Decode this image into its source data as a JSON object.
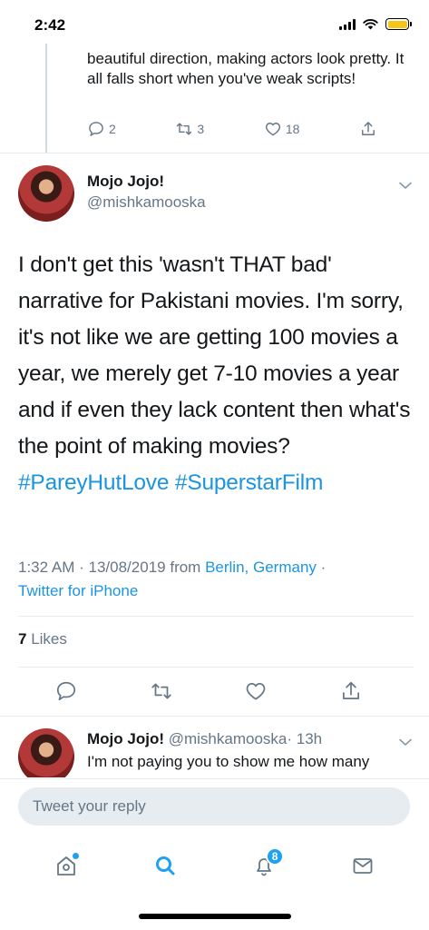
{
  "status_bar": {
    "time": "2:42"
  },
  "previous_tweet": {
    "text": "beautiful direction, making actors look pretty. It all falls short when you've weak scripts!",
    "reply_count": "2",
    "retweet_count": "3",
    "like_count": "18",
    "icons": [
      "reply-icon",
      "retweet-icon",
      "like-icon",
      "share-icon"
    ]
  },
  "main_tweet": {
    "author_name": "Mojo Jojo!",
    "author_handle": "@mishkamooska",
    "text": "I don't get this 'wasn't THAT bad' narrative for Pakistani movies. I'm sorry, it's not like we are getting 100 movies a year, we merely get 7-10 movies a year and if even they lack content then what's the point of making movies?",
    "hashtags": [
      "#PareyHutLove",
      "#SuperstarFilm"
    ],
    "time": "1:32 AM",
    "date": "13/08/2019",
    "from_label": "from",
    "location": "Berlin, Germany",
    "separator": "·",
    "client": "Twitter for iPhone",
    "likes_count": "7",
    "likes_label": "Likes"
  },
  "reply_preview": {
    "author_name": "Mojo Jojo!",
    "author_handle": "@mishkamooska",
    "time_ago": "· 13h",
    "text": "I'm not paying you to show me how many"
  },
  "composer": {
    "placeholder": "Tweet your reply"
  },
  "tabbar": {
    "notifications_badge": "8",
    "tabs": [
      "home-icon",
      "search-icon",
      "notifications-icon",
      "messages-icon"
    ]
  },
  "colors": {
    "accent": "#1da1f2",
    "link": "#1b95e0",
    "muted": "#657786",
    "text": "#14171a",
    "battery": "#f5c518"
  }
}
